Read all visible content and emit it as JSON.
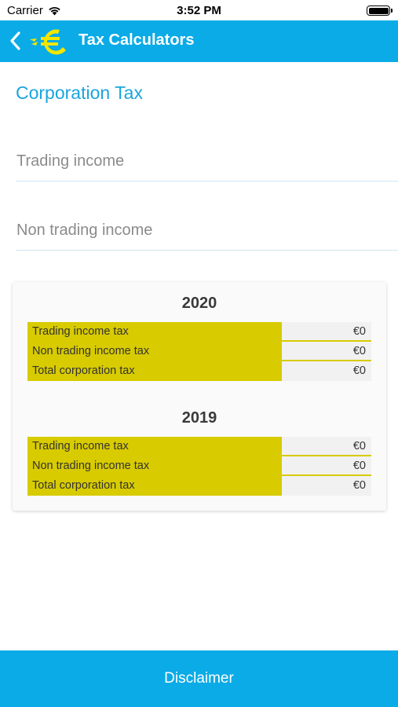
{
  "status_bar": {
    "carrier": "Carrier",
    "time": "3:52 PM"
  },
  "nav": {
    "title": "Tax Calculators",
    "back_icon": "chevron-left-icon",
    "logo_icon": "euro-logo-icon"
  },
  "page": {
    "title": "Corporation Tax"
  },
  "form": {
    "trading_income_placeholder": "Trading income",
    "trading_income_value": "",
    "non_trading_income_placeholder": "Non trading income",
    "non_trading_income_value": ""
  },
  "results": [
    {
      "year": "2020",
      "rows": [
        {
          "label": "Trading income tax",
          "value": "€0"
        },
        {
          "label": "Non trading income tax",
          "value": "€0"
        },
        {
          "label": "Total corporation tax",
          "value": "€0"
        }
      ]
    },
    {
      "year": "2019",
      "rows": [
        {
          "label": "Trading income tax",
          "value": "€0"
        },
        {
          "label": "Non trading income tax",
          "value": "€0"
        },
        {
          "label": "Total corporation tax",
          "value": "€0"
        }
      ]
    }
  ],
  "footer": {
    "disclaimer_label": "Disclaimer"
  },
  "colors": {
    "brand_blue": "#0aabe6",
    "title_blue": "#1aa5df",
    "highlight_yellow": "#d8cb00"
  }
}
